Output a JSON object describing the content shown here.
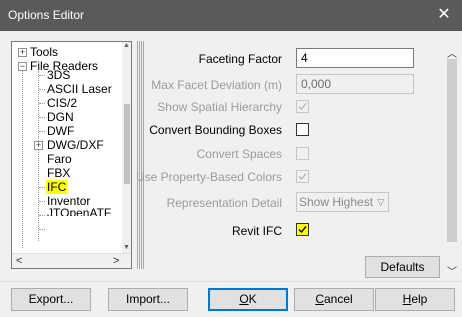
{
  "window": {
    "title": "Options Editor",
    "close_glyph": "✕"
  },
  "tree": {
    "items": [
      {
        "label": "Tools",
        "expander": "+"
      },
      {
        "label": "File Readers",
        "expander": "−"
      },
      {
        "label": "3DS"
      },
      {
        "label": "ASCII Laser"
      },
      {
        "label": "CIS/2"
      },
      {
        "label": "DGN"
      },
      {
        "label": "DWF"
      },
      {
        "label": "DWG/DXF",
        "expander": "+"
      },
      {
        "label": "Faro"
      },
      {
        "label": "FBX"
      },
      {
        "label": "IFC",
        "selected": true
      },
      {
        "label": "Inventor"
      },
      {
        "label": "JTOpenATF"
      }
    ]
  },
  "properties": {
    "faceting_factor": {
      "label": "Faceting Factor",
      "value": "4"
    },
    "max_facet_deviation": {
      "label": "Max Facet Deviation (m)",
      "value": "0,000"
    },
    "show_spatial_hierarchy": {
      "label": "Show Spatial Hierarchy",
      "checked": true
    },
    "convert_bounding_boxes": {
      "label": "Convert Bounding Boxes",
      "checked": false
    },
    "convert_spaces": {
      "label": "Convert Spaces",
      "checked": false
    },
    "use_property_colors": {
      "label": "Use Property-Based Colors",
      "checked": true
    },
    "representation_detail": {
      "label": "Representation Detail",
      "value": "Show Highest"
    },
    "revit_ifc": {
      "label": "Revit IFC",
      "checked": true
    }
  },
  "buttons": {
    "defaults": "Defaults",
    "export": "Export...",
    "import": "Import...",
    "ok_key": "O",
    "ok_rest": "K",
    "cancel_key": "C",
    "cancel_rest": "ancel",
    "help_key": "H",
    "help_rest": "elp"
  },
  "colors": {
    "titlebar": "#5a5a5a",
    "highlight": "#ffff00",
    "focus": "#0078d7"
  }
}
